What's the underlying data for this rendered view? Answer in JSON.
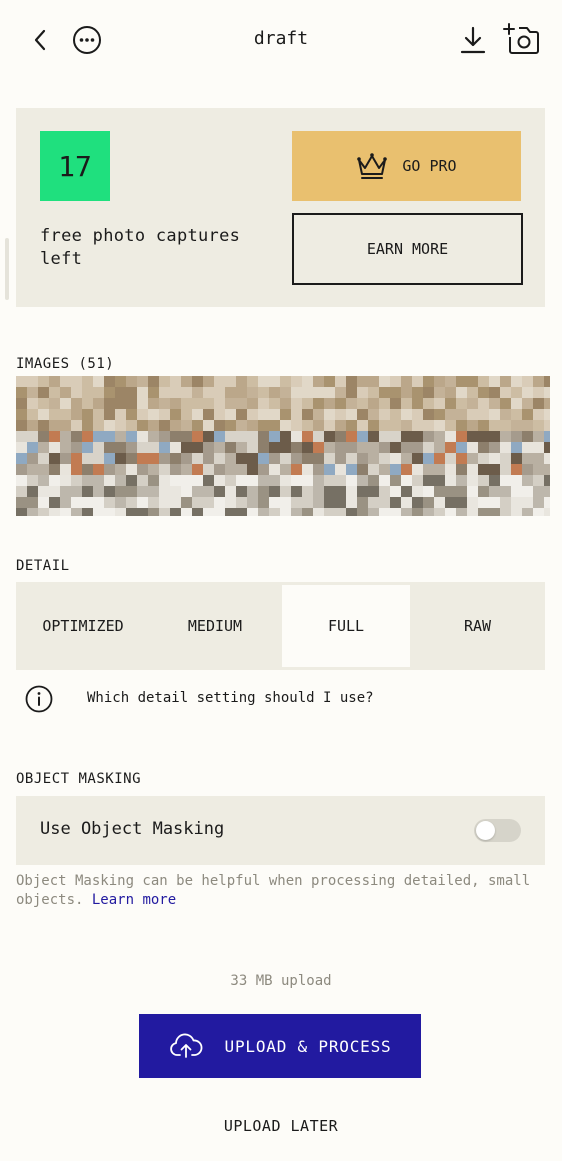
{
  "header": {
    "title": "draft",
    "back_icon": "chevron-left-icon",
    "more_icon": "more-horizontal-icon",
    "download_icon": "download-icon",
    "camera_icon": "add-camera-icon"
  },
  "promo": {
    "captures_count": "17",
    "captures_text": "free photo captures left",
    "go_pro_label": "GO PRO",
    "go_pro_icon": "crown-icon",
    "earn_more_label": "EARN MORE",
    "badge_color": "#1fe07e",
    "go_pro_color": "#e9c06f"
  },
  "images": {
    "heading": "IMAGES (51)"
  },
  "detail": {
    "heading": "DETAIL",
    "options": [
      "OPTIMIZED",
      "MEDIUM",
      "FULL",
      "RAW"
    ],
    "selected": "FULL",
    "help_text": "Which detail setting should I use?",
    "help_icon": "info-icon"
  },
  "masking": {
    "heading": "OBJECT MASKING",
    "toggle_label": "Use Object Masking",
    "toggle_on": false,
    "note": "Object Masking can be helpful when processing detailed, small objects.",
    "learn_more": "Learn more"
  },
  "upload": {
    "size_text": "33 MB upload",
    "process_label": "UPLOAD & PROCESS",
    "upload_icon": "cloud-upload-icon",
    "later_label": "UPLOAD LATER",
    "accent_color": "#221aa0"
  }
}
